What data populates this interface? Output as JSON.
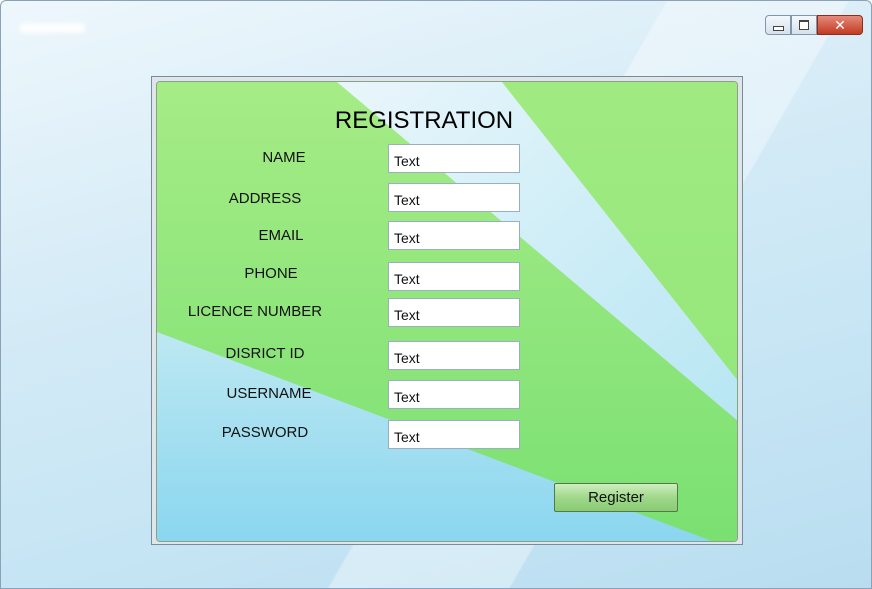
{
  "window": {
    "controls": {
      "minimize": "minimize",
      "maximize": "maximize",
      "close": "close"
    }
  },
  "form": {
    "title": "REGISTRATION",
    "fields": [
      {
        "label": "NAME",
        "value": "Text"
      },
      {
        "label": "ADDRESS",
        "value": "Text"
      },
      {
        "label": "EMAIL",
        "value": "Text"
      },
      {
        "label": "PHONE",
        "value": "Text"
      },
      {
        "label": "LICENCE NUMBER",
        "value": "Text"
      },
      {
        "label": "DISRICT ID",
        "value": "Text"
      },
      {
        "label": "USERNAME",
        "value": "Text"
      },
      {
        "label": "PASSWORD",
        "value": "Text"
      }
    ],
    "register_label": "Register"
  },
  "colors": {
    "panel_green": "#8ee67a",
    "panel_blue": "#a9e3f5",
    "close_red": "#c23a22"
  }
}
